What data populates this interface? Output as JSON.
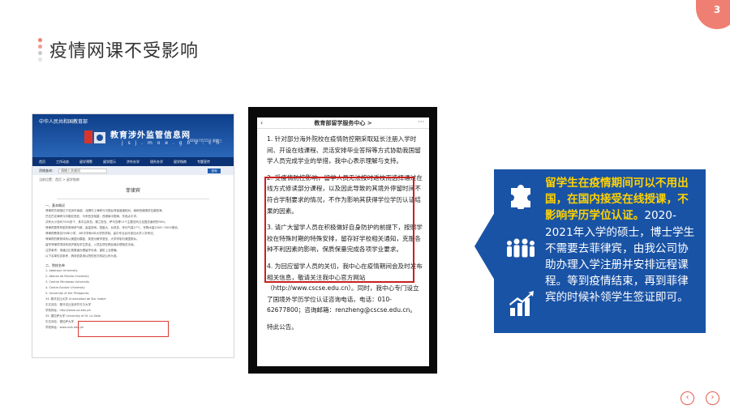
{
  "page_number": "3",
  "title": "疫情网课不受影响",
  "website": {
    "ministry": "中华人民共和国教育部",
    "site_name": "教育涉外监管信息网",
    "domain": "j s j . m o e . g o v . c n",
    "date": "2020年7月15日 星期三",
    "nav": [
      "首页",
      "工作动态",
      "留学预警",
      "留学提示",
      "涉外办学",
      "境外办学",
      "留学指南",
      "专题宣传"
    ],
    "search_label": "资格查询：",
    "search_placeholder": "请输入关键词",
    "search_button": "查询",
    "breadcrumb": "当前位置：首页 > 留学指南",
    "page_title": "菲律宾",
    "section1": "一、基本概况",
    "body_lines": [
      "菲律宾共和国位于亚洲东南部。北隔巴士海峡与中国台湾省遥遥相对，南和西南隔苏拉威西海、",
      "巴拉巴克海峡与印度尼西亚、马来西亚相望，西濒南中国海，东临太平洋。",
      "共有大小岛屿7000多个，其中吕宋岛、棉兰老岛、萨马岛等11个主要岛屿占全国总面积的96%。",
      "菲律宾属季风型热带雨林气候，高温多雨，湿度大，台风多。年均气温27℃，年降水量2000～3000毫米。",
      "菲律宾教育实行6年小学、4年中学和4年大学的学制。高中毕业后可参加大学入学考试。",
      "菲律宾的教育体系以美国为模板，英语为教学语言，大学学制与美国类似。",
      "留学菲律宾须持有效护照及学生签证，入境后须在移民局办理相关手续。",
      "注意事项：请通过正规渠道办理留学手续，谨防上当受骗。",
      "以下名单仅供参考，具体信息请以院校官方网站公布为准。"
    ],
    "section2": "二、院校名单",
    "uni_lines": [
      "1. Adamson University",
      "2. Ateneo de Manila University",
      "3. Central Mindanao University",
      "4. Centro Escolar University",
      "5. University of the Philippines"
    ],
    "hl_lines": [
      "34. 黎牙实比大学 Universidad de Sta. Isabel",
      "中文译名：黎牙实比圣伊莎贝尔大学",
      "学校网址：http://www.usi.edu.ph"
    ],
    "tail_lines": [
      "35. 德拉萨大学 University of St. La Salle",
      "中文译名：德拉萨大学",
      "学校网址：www.usls.edu.ph"
    ]
  },
  "phone": {
    "header": "教育部留学服务中心 >",
    "back": "‹",
    "more": "···",
    "paragraphs": [
      "1. 针对部分海外院校在疫情防控期采取延长注册入学时间、开设在线课程、灵活安排毕业答辩等方式协助我国留学人员完成学业的举措，我中心表示理解与支持。",
      "2. 受疫情防控影响，留学人员无法按时返校而选择通过在线方式修读部分课程，以及因此导致的其境外停留时间不符合学制要求的情况，不作为影响其获得学位学历认证结果的因素。",
      "3. 请广大留学人员在积极做好自身防护的前提下，按照学校在特殊时期的特殊安排，留存好学校相关通知，克服各种不利因素的影响，保质保量完成各项学业要求。",
      "4. 为回应留学人员的关切，我中心在疫情期间会及时发布相关信息，敬请关注我中心官方网站（http://www.cscse.edu.cn）。同时，我中心专门设立了国境外学历学位认证咨询电话，电话：010-62677800；咨询邮箱：renzheng@cscse.edu.cn。",
      "特此公告。"
    ]
  },
  "callout": {
    "highlight": "留学生在疫情期间可以不用出国，在国内接受在线授课，不影响学历学位认证。",
    "body": "2020-2021年入学的硕士，博士学生不需要去菲律宾，由我公司协助办理入学注册并安排远程课程。等到疫情结束，再到菲律宾的时候补领学生签证即可。"
  },
  "colors": {
    "accent": "#f07f73",
    "callout_bg": "#1953a6",
    "highlight": "#ffd200",
    "phone_box": "#c9211e"
  },
  "icons": [
    "puzzle-icon",
    "people-group-icon",
    "growth-chart-icon",
    "prev-arrow-icon",
    "next-arrow-icon"
  ]
}
